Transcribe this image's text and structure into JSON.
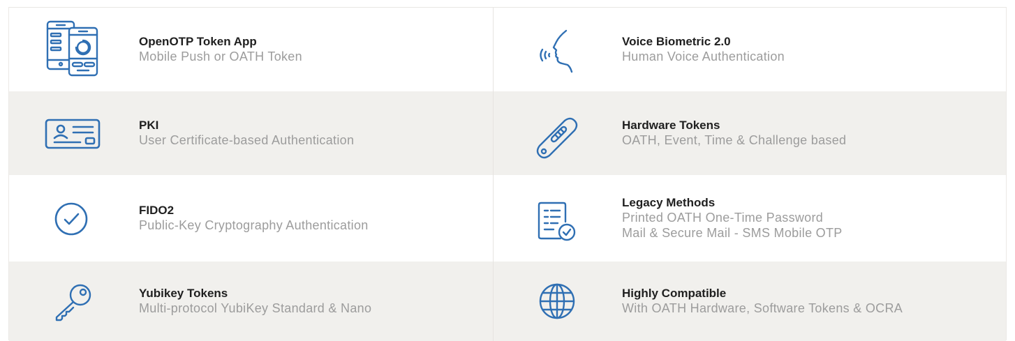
{
  "accent_color": "#2f6fb3",
  "features": {
    "rows": [
      {
        "left": {
          "icon": "mobile-phones-icon",
          "title": "OpenOTP Token App",
          "lines": [
            "Mobile Push or OATH Token"
          ]
        },
        "right": {
          "icon": "voice-biometric-icon",
          "title": "Voice Biometric 2.0",
          "lines": [
            "Human Voice Authentication"
          ]
        }
      },
      {
        "left": {
          "icon": "id-card-icon",
          "title": "PKI",
          "lines": [
            "User Certificate-based Authentication"
          ]
        },
        "right": {
          "icon": "hardware-token-icon",
          "title": "Hardware Tokens",
          "lines": [
            "OATH, Event, Time & Challenge based"
          ]
        }
      },
      {
        "left": {
          "icon": "check-circle-icon",
          "title": "FIDO2",
          "lines": [
            "Public-Key Cryptography Authentication"
          ]
        },
        "right": {
          "icon": "document-check-icon",
          "title": "Legacy Methods",
          "lines": [
            "Printed OATH One-Time Password",
            "Mail & Secure Mail - SMS Mobile OTP"
          ]
        }
      },
      {
        "left": {
          "icon": "key-icon",
          "title": "Yubikey Tokens",
          "lines": [
            "Multi-protocol YubiKey Standard & Nano"
          ]
        },
        "right": {
          "icon": "globe-icon",
          "title": "Highly Compatible",
          "lines": [
            "With OATH Hardware, Software Tokens & OCRA"
          ]
        }
      }
    ]
  }
}
